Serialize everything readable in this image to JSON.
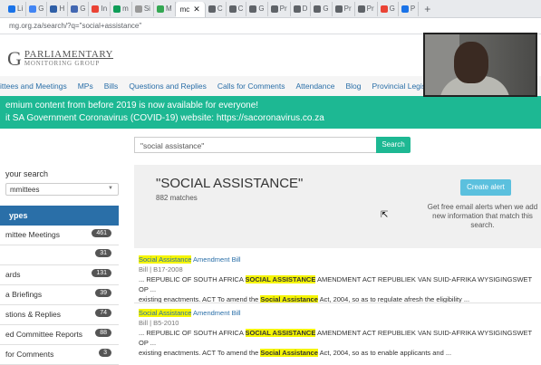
{
  "browser": {
    "tabs": [
      {
        "icon_color": "#1a73e8",
        "label": "Li"
      },
      {
        "icon_color": "#4285f4",
        "label": "G"
      },
      {
        "icon_color": "#2f5fa7",
        "label": "H"
      },
      {
        "icon_color": "#4267b2",
        "label": "G"
      },
      {
        "icon_color": "#ea4335",
        "label": "In"
      },
      {
        "icon_color": "#0f9d58",
        "label": "m"
      },
      {
        "icon_color": "#999999",
        "label": "Si"
      },
      {
        "icon_color": "#34a853",
        "label": "M"
      },
      {
        "icon_color": "#5f6368",
        "label": "C"
      },
      {
        "icon_color": "#5f6368",
        "label": "C"
      },
      {
        "icon_color": "#5f6368",
        "label": "G"
      },
      {
        "icon_color": "#5f6368",
        "label": "Pr"
      },
      {
        "icon_color": "#5f6368",
        "label": "D"
      },
      {
        "icon_color": "#5f6368",
        "label": "G"
      },
      {
        "icon_color": "#5f6368",
        "label": "Pr"
      },
      {
        "icon_color": "#5f6368",
        "label": "Pr"
      },
      {
        "icon_color": "#ea4335",
        "label": "G"
      },
      {
        "icon_color": "#1a73e8",
        "label": "P"
      }
    ],
    "active_tab_label": "mc",
    "url": "mg.org.za/search/?q=\"social+assistance\""
  },
  "header": {
    "logo_letter": "G",
    "logo_line1": "PARLIAMENTARY",
    "logo_line2": "MONITORING GROUP"
  },
  "nav": {
    "items": [
      "ittees and Meetings",
      "MPs",
      "Bills",
      "Questions and Replies",
      "Calls for Comments",
      "Attendance",
      "Blog",
      "Provincial Legislatures"
    ]
  },
  "banner": {
    "line1": "emium content from before 2019 is now available for everyone!",
    "line2": "it SA Government Coronavirus (COVID-19) website: https://sacoronavirus.co.za"
  },
  "search": {
    "query": "\"social assistance\"",
    "button_label": "Search"
  },
  "sidebar": {
    "refine_label": "your search",
    "select_value": "mmittees",
    "types_heading": "ypes",
    "items": [
      {
        "label": "mittee Meetings",
        "count": "461"
      },
      {
        "label": "",
        "count": "31"
      },
      {
        "label": "ards",
        "count": "131"
      },
      {
        "label": "a Briefings",
        "count": "39"
      },
      {
        "label": "stions & Replies",
        "count": "74"
      },
      {
        "label": "ed Committee Reports",
        "count": "88"
      },
      {
        "label": "for Comments",
        "count": "3"
      }
    ]
  },
  "results_header": {
    "title": "\"SOCIAL ASSISTANCE\"",
    "count": "882 matches",
    "alert_button": "Create alert",
    "alert_text": "Get free email alerts when we add new information that match this search."
  },
  "results": [
    {
      "title_hl": "Social Assistance",
      "title_rest": " Amendment Bill",
      "meta": "Bill | B17-2008",
      "line1_pre": "... REPUBLIC OF SOUTH AFRICA ",
      "line1_hl": "SOCIAL ASSISTANCE",
      "line1_post": " AMENDMENT ACT REPUBLIEK VAN SUID-AFRIKA WYSIGINGSWET OP ...",
      "line2_pre": "existing enactments. ACT To amend the ",
      "line2_hl": "Social Assistance",
      "line2_post": " Act, 2004, so as to regulate afresh the eligibility ..."
    },
    {
      "title_hl": "Social Assistance",
      "title_rest": " Amendment Bill",
      "meta": "Bill | B5-2010",
      "line1_pre": "... REPUBLIC OF SOUTH AFRICA ",
      "line1_hl": "SOCIAL ASSISTANCE",
      "line1_post": " AMENDMENT ACT REPUBLIEK VAN SUID-AFRIKA WYSIGINGSWET OP ...",
      "line2_pre": "existing enactments. ACT To amend the ",
      "line2_hl": "Social Assistance",
      "line2_post": " Act, 2004, so as to enable applicants and ..."
    }
  ],
  "colors": {
    "accent_green": "#1db893",
    "link_blue": "#2a6fa8",
    "highlight": "#f5f500"
  }
}
